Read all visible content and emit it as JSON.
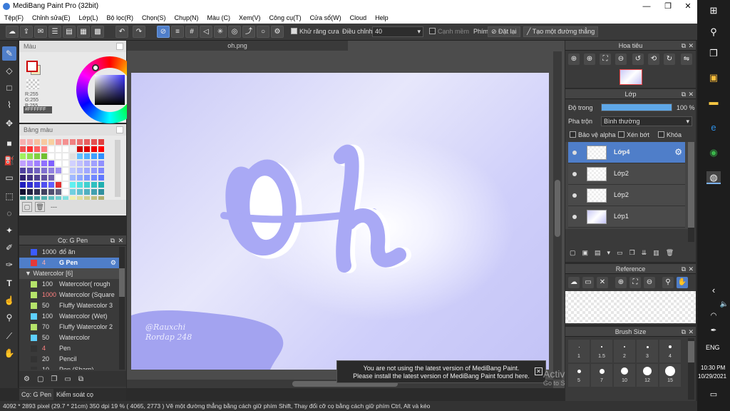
{
  "window": {
    "title": "MediBang Paint Pro (32bit)"
  },
  "menu": [
    "Tệp(F)",
    "Chỉnh sửa(E)",
    "Lớp(L)",
    "Bộ lọc(R)",
    "Chọn(S)",
    "Chụp(N)",
    "Màu (C)",
    "Xem(V)",
    "Công cụ(T)",
    "Cửa sổ(W)",
    "Cloud",
    "Help"
  ],
  "toolbar": {
    "antialias_label": "Khử răng cưa",
    "correction_label": "Điều chỉnh",
    "correction_value": "40",
    "smooth_label": "Cạnh mềm",
    "shortcut_label": "Phím",
    "set_label": "Đặt lại",
    "line_label": "Tạo một đường thẳng"
  },
  "color_panel": {
    "title": "Màu",
    "r": "R:255",
    "g": "G:255",
    "b": "B:255",
    "hex": "#FFFFFF"
  },
  "palette_panel": {
    "title": "Bảng màu",
    "footer": "---"
  },
  "brush_panel": {
    "title": "Cọ: G Pen",
    "rows": [
      {
        "num": "1000",
        "name": "đổ ăn",
        "color": "#3b5bff",
        "kind": "item"
      },
      {
        "num": "4",
        "name": "G Pen",
        "color": "#e53939",
        "kind": "active"
      },
      {
        "num": "",
        "name": "Watercolor [6]",
        "color": "",
        "kind": "group"
      },
      {
        "num": "100",
        "name": "Watercolor( rough",
        "color": "#b5e36a",
        "kind": "item"
      },
      {
        "num": "1000",
        "name": "Watercolor (Square",
        "color": "#b5e36a",
        "kind": "item"
      },
      {
        "num": "50",
        "name": "Fluffy Watercolor 3",
        "color": "#b5e36a",
        "kind": "item"
      },
      {
        "num": "100",
        "name": "Watercolor (Wet)",
        "color": "#5ed0ff",
        "kind": "item"
      },
      {
        "num": "70",
        "name": "Fluffy Watercolor 2",
        "color": "#b5e36a",
        "kind": "item"
      },
      {
        "num": "50",
        "name": "Watercolor",
        "color": "#5ed0ff",
        "kind": "item"
      },
      {
        "num": "4",
        "name": "Pen",
        "color": "#333333",
        "kind": "item"
      },
      {
        "num": "20",
        "name": "Pencil",
        "color": "#333333",
        "kind": "item"
      },
      {
        "num": "10",
        "name": "Pen (Sharp)",
        "color": "#333333",
        "kind": "item"
      }
    ],
    "tabs": [
      "Cọ: G Pen",
      "Kiểm soát cọ"
    ]
  },
  "document": {
    "tab": "oh.png",
    "signature": "@Rauxchi Rordap 248"
  },
  "navigator": {
    "title": "Hoa tiêu"
  },
  "layer_panel": {
    "title": "Lớp",
    "opacity_label": "Độ trong",
    "opacity_value": "100 %",
    "opacity_fraction": 1.0,
    "blend_label": "Pha trộn",
    "blend_value": "Bình thường",
    "protect_alpha": "Bảo vệ alpha",
    "clipping": "Xén bớt",
    "lock": "Khóa",
    "layers": [
      "Lớp4",
      "Lớp2",
      "Lớp2",
      "Lớp1"
    ]
  },
  "reference_panel": {
    "title": "Reference"
  },
  "brushsize_panel": {
    "title": "Brush Size",
    "sizes": [
      "1",
      "1.5",
      "2",
      "3",
      "4",
      "5",
      "7",
      "10",
      "12",
      "15"
    ]
  },
  "status": {
    "text": "4092 * 2893 pixel   (29.7 * 21cm)   350 dpi   19 %   ( 4065, 2773 )   Vẽ một đường thẳng bằng cách giữ phím Shift, Thay đổi cỡ cọ bằng cách giữ phím Ctrl, Alt và kéo"
  },
  "notice": {
    "line1": "You are not using the latest version of MediBang Paint.",
    "line2": "Please install the latest version of MediBang Paint found here."
  },
  "watermark": {
    "line1": "Activate Windows",
    "line2": "Go to Settings to activate Windows."
  },
  "taskbar": {
    "lang": "ENG",
    "time": "10:30 PM",
    "date": "10/29/2021"
  },
  "colors": {
    "accent": "#4f7ec9",
    "canvas_lilac": "#a9a9f5"
  }
}
